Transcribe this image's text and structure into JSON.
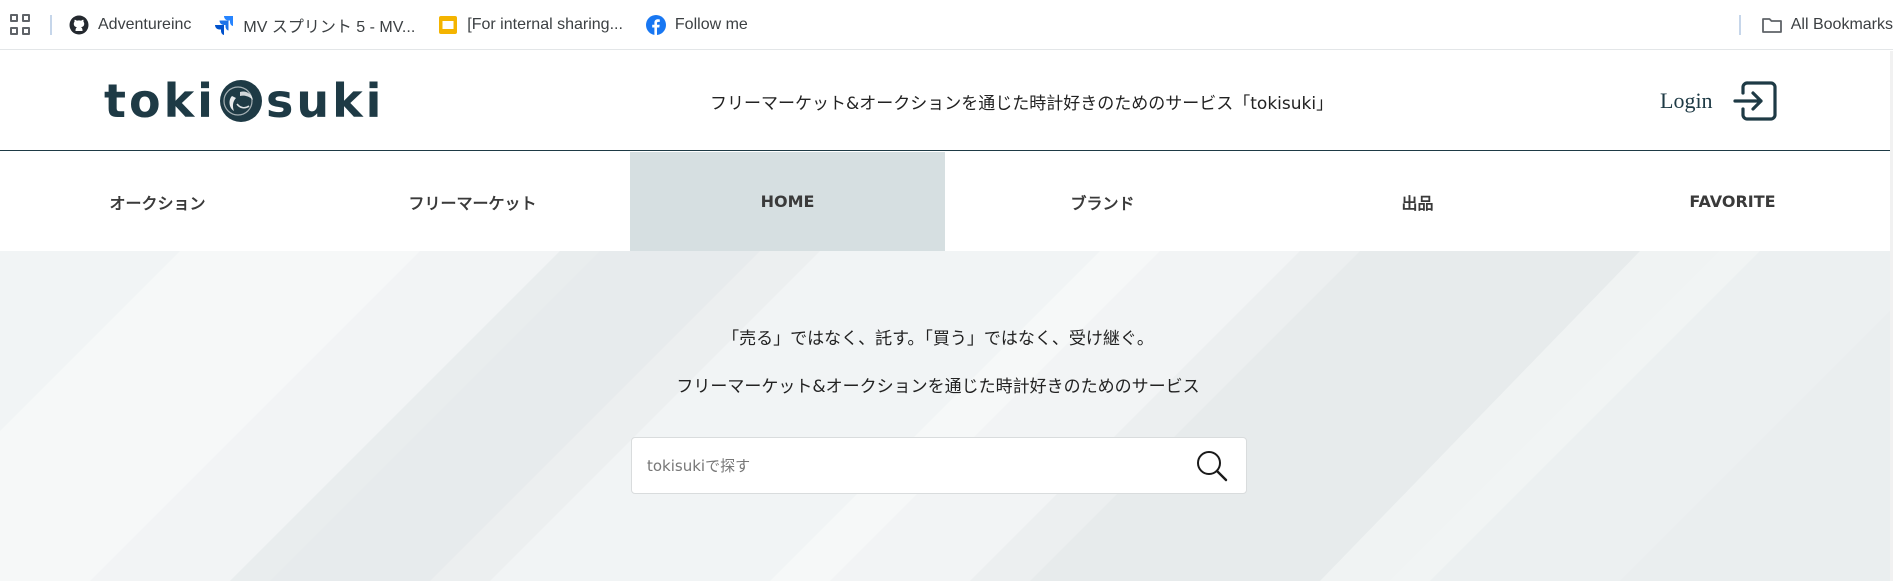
{
  "bookmarks_bar": {
    "items": [
      {
        "label": "Adventureinc",
        "icon": "github-icon"
      },
      {
        "label": "MV スプリント 5 - MV...",
        "icon": "jira-icon"
      },
      {
        "label": "[For internal sharing...",
        "icon": "slides-icon"
      },
      {
        "label": "Follow me",
        "icon": "facebook-icon"
      }
    ],
    "all_bookmarks": "All Bookmarks"
  },
  "header": {
    "logo_left": "toki",
    "logo_right": "suki",
    "tagline": "フリーマーケット&オークションを通じた時計好きのためのサービス「tokisuki」",
    "login_label": "Login"
  },
  "nav": {
    "items": [
      {
        "label": "オークション"
      },
      {
        "label": "フリーマーケット"
      },
      {
        "label": "HOME",
        "active": true
      },
      {
        "label": "ブランド"
      },
      {
        "label": "出品"
      },
      {
        "label": "FAVORITE"
      }
    ]
  },
  "hero": {
    "line1": "「売る」ではなく、託す。「買う」ではなく、受け継ぐ。",
    "line2": "フリーマーケット&オークションを通じた時計好きのためのサービス",
    "search_placeholder": "tokisukiで探す"
  },
  "colors": {
    "brand": "#1e3a45",
    "nav_active_bg": "#d6dfe1",
    "hero_bg": "#eceff0"
  }
}
